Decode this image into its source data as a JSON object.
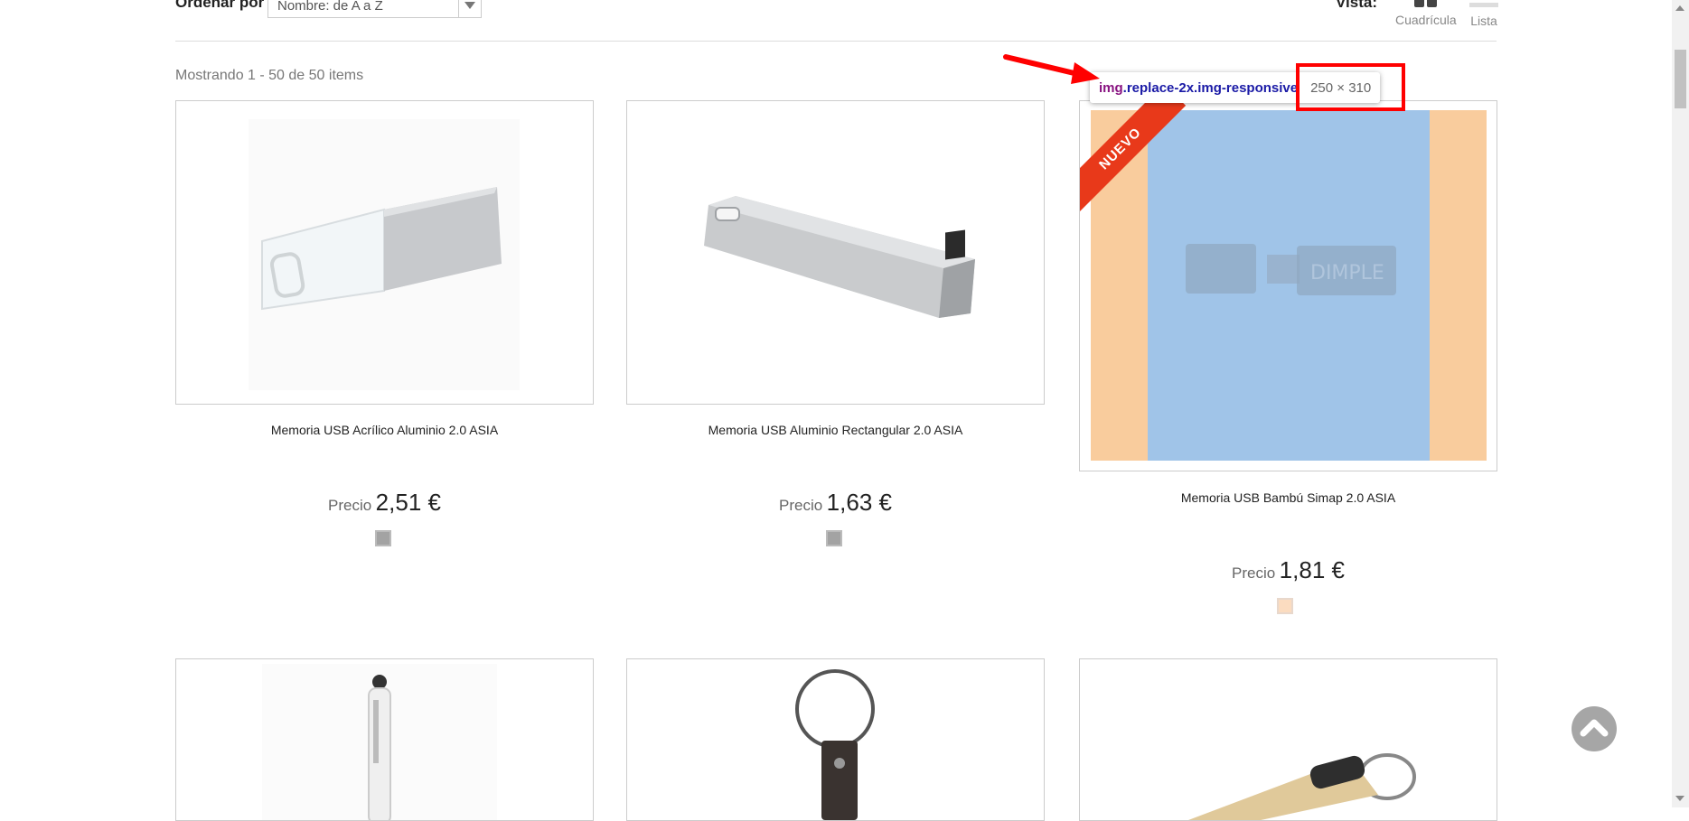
{
  "toolbar": {
    "sort_label": "Ordenar por",
    "sort_value": "Nombre: de A a Z",
    "view_label": "Vista:",
    "view_grid": "Cuadrícula",
    "view_list": "Lista"
  },
  "results_count": "Mostrando 1 - 50 de 50 items",
  "products": [
    {
      "name": "Memoria USB Acrílico Aluminio 2.0 ASIA",
      "price_label": "Precio",
      "price": "2,51 €",
      "swatch_color": "#a3a3a3"
    },
    {
      "name": "Memoria USB Aluminio Rectangular 2.0 ASIA",
      "price_label": "Precio",
      "price": "1,63 €",
      "swatch_color": "#a3a3a3"
    },
    {
      "name": "Memoria USB Bambú Simap 2.0 ASIA",
      "price_label": "Precio",
      "price": "1,81 €",
      "swatch_color": "#fbdcc0",
      "badge": "NUEVO"
    }
  ],
  "devtools_tooltip": {
    "selector_tag": "img",
    "selector_classes": ".replace-2x.img-responsive",
    "dimensions": "250 × 310"
  },
  "colors": {
    "accent_red": "#ff0000",
    "badge_red": "#e8391a",
    "overlay_blue": "#a0c4e8",
    "overlay_orange": "#f9cc9d"
  }
}
